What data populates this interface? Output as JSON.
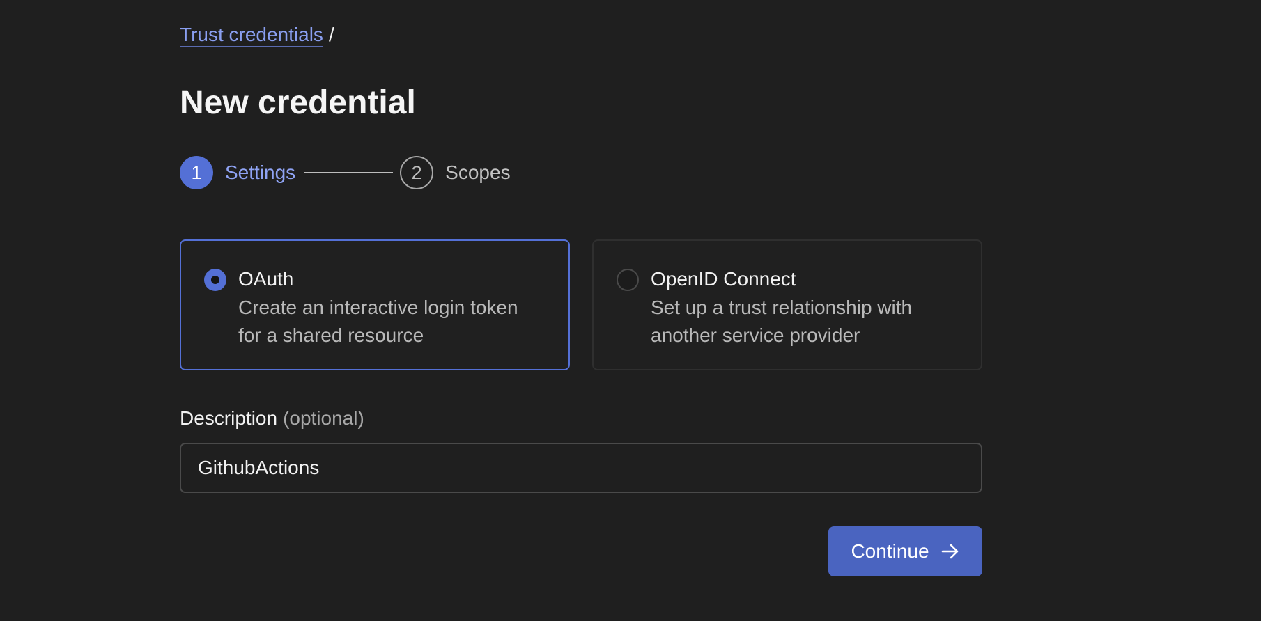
{
  "breadcrumb": {
    "link_label": "Trust credentials",
    "separator": "/"
  },
  "page": {
    "title": "New credential"
  },
  "stepper": {
    "steps": [
      {
        "number": "1",
        "label": "Settings",
        "state": "active"
      },
      {
        "number": "2",
        "label": "Scopes",
        "state": "inactive"
      }
    ]
  },
  "options": [
    {
      "title": "OAuth",
      "description": "Create an interactive login token for a shared resource",
      "selected": true
    },
    {
      "title": "OpenID Connect",
      "description": "Set up a trust relationship with another service provider",
      "selected": false
    }
  ],
  "description_field": {
    "label": "Description",
    "label_suffix": "(optional)",
    "value": "GithubActions"
  },
  "actions": {
    "continue_label": "Continue",
    "continue_icon": "arrow-right-icon"
  },
  "colors": {
    "background": "#1f1f1f",
    "accent": "#5470d6",
    "button": "#4a64c0",
    "link": "#8a9ff0"
  }
}
